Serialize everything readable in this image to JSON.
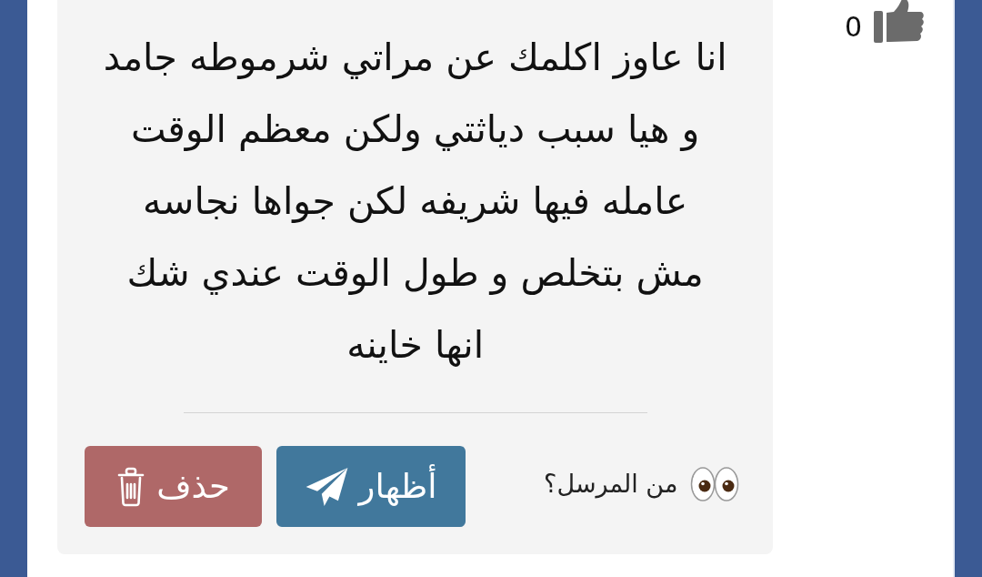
{
  "likes": {
    "count": "0"
  },
  "message": {
    "lines": [
      "انا عاوز اكلمك عن مراتي شرموطه جامد",
      "و هيا سبب دياثتي ولكن معظم الوقت",
      "عامله فيها شريفه لكن جواها نجاسه",
      "مش بتخلص و طول الوقت عندي شك",
      "انها خاينه"
    ]
  },
  "actions": {
    "sender_prompt": "من المرسل؟",
    "buttons": [
      {
        "kind": "reveal",
        "label": "أظهار"
      },
      {
        "kind": "delete",
        "label": "حذف"
      }
    ]
  }
}
